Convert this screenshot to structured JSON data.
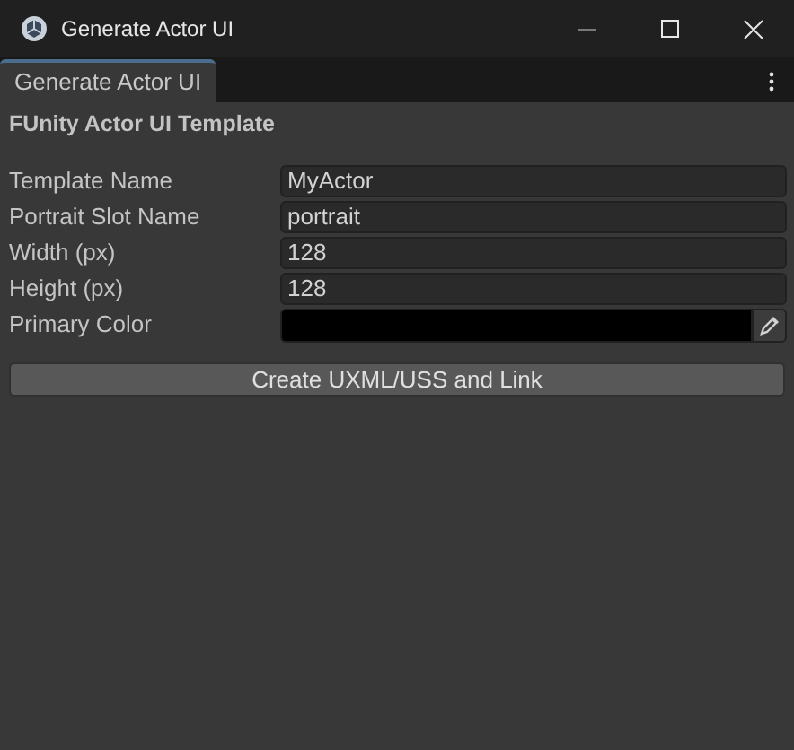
{
  "window": {
    "title": "Generate Actor UI"
  },
  "tabs": [
    {
      "label": "Generate Actor UI",
      "selected": true
    }
  ],
  "section_title": "FUnity Actor UI Template",
  "fields": [
    {
      "kind": "text",
      "label": "Template Name",
      "value": "MyActor"
    },
    {
      "kind": "text",
      "label": "Portrait Slot Name",
      "value": "portrait"
    },
    {
      "kind": "text",
      "label": "Width (px)",
      "value": "128"
    },
    {
      "kind": "text",
      "label": "Height (px)",
      "value": "128"
    },
    {
      "kind": "color",
      "label": "Primary Color",
      "color": "#000000"
    }
  ],
  "button": "Create UXML/USS and Link"
}
